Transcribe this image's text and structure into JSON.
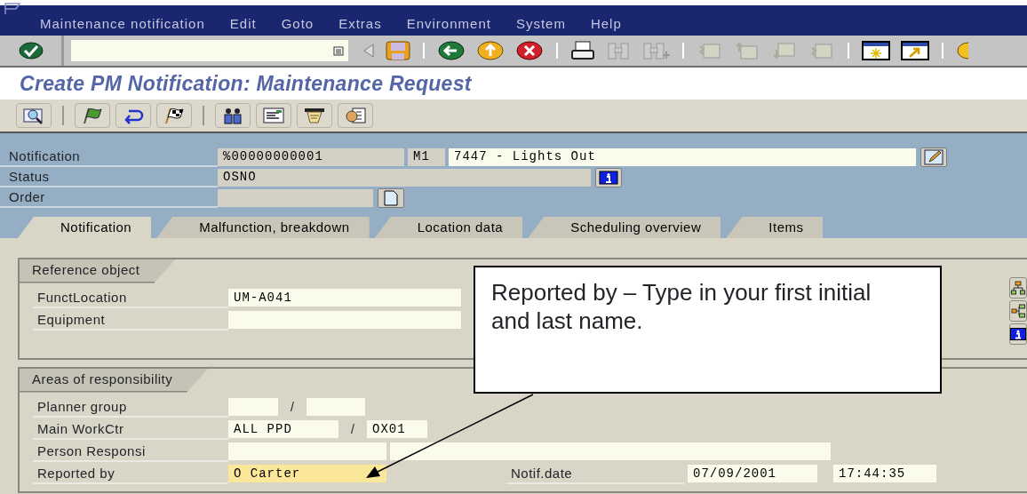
{
  "menu_bar": [
    {
      "label": "Maintenance notification"
    },
    {
      "label": "Edit"
    },
    {
      "label": "Goto"
    },
    {
      "label": "Extras"
    },
    {
      "label": "Environment"
    },
    {
      "label": "System"
    },
    {
      "label": "Help"
    }
  ],
  "title": "Create PM Notification: Maintenance Request",
  "header": {
    "notification": {
      "label": "Notification",
      "number": "%00000000001",
      "type": "M1",
      "description": "7447 - Lights Out"
    },
    "status": {
      "label": "Status",
      "value": "OSNO"
    },
    "order": {
      "label": "Order"
    }
  },
  "tabs": [
    {
      "label": "Notification",
      "selected": true
    },
    {
      "label": "Malfunction, breakdown",
      "selected": false
    },
    {
      "label": "Location data",
      "selected": false
    },
    {
      "label": "Scheduling overview",
      "selected": false
    },
    {
      "label": "Items",
      "selected": false
    }
  ],
  "reference_object": {
    "title": "Reference object",
    "rows": [
      {
        "label": "FunctLocation",
        "value": "UM-A041"
      },
      {
        "label": "Equipment"
      }
    ]
  },
  "responsibility": {
    "title": "Areas of responsibility",
    "rows": [
      {
        "label": "Planner group",
        "separator": "/",
        "fields": [
          {
            "focused": false
          },
          {
            "focused": false
          }
        ]
      },
      {
        "label": "Main WorkCtr",
        "separator": "/",
        "fields": [
          {
            "value": "ALL PPD",
            "focused": false
          },
          {
            "value": "OX01",
            "focused": false
          }
        ]
      },
      {
        "label": "Person Responsi",
        "fields": [
          {
            "focused": false
          },
          {
            "focused": false
          }
        ]
      },
      {
        "label": "Reported by",
        "fields": [
          {
            "value": "O Carter",
            "focused": true
          }
        ],
        "date_label": "Notif.date",
        "date": "07/09/2001",
        "time": "17:44:35"
      }
    ]
  },
  "callout": {
    "text": "Reported by – Type in your first initial and last name."
  }
}
